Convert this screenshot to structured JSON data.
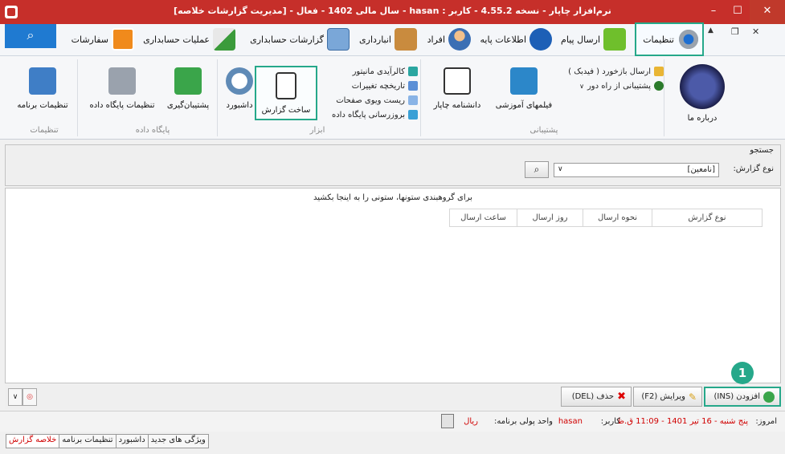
{
  "window": {
    "title": "نرم‌افزار چاپار - نسخه 4.55.2 - کاربر : hasan - سال مالی 1402 - فعال - [مدیریت گزارشات خلاصه]",
    "min": "–",
    "max": "☐",
    "close": "✕"
  },
  "tabs": [
    {
      "id": "settings",
      "label": "تنظیمات"
    },
    {
      "id": "send-message",
      "label": "ارسال پیام"
    },
    {
      "id": "base-info",
      "label": "اطلاعات پایه"
    },
    {
      "id": "people",
      "label": "افراد"
    },
    {
      "id": "warehouse",
      "label": "انبارداری"
    },
    {
      "id": "accounting-reports",
      "label": "گزارشات حسابداری"
    },
    {
      "id": "accounting-ops",
      "label": "عملیات حسابداری"
    },
    {
      "id": "orders",
      "label": "سفارشات"
    }
  ],
  "ribbon": {
    "about": "درباره ما",
    "feedback": "ارسال  بازخورد ( فیدبک )",
    "remote_support": "پشتیبانی از راه دور",
    "training_videos": "فیلمهای آموزشی",
    "chapar_encyclopedia": "دانشنامه چاپار",
    "support_group": "پشتیبانی",
    "monitor_calendar": "کالرآیدی مانیتور",
    "change_history": "تاریخچه تغییرات",
    "reset_pages": "ریست ویوی صفحات",
    "update_db": "بروزرسانی پایگاه داده",
    "build_report": "ساخت گزارش",
    "dashboard": "داشبورد",
    "tools_group": "ابزار",
    "backup": "پشتیبان‌گیری",
    "db_settings": "تنظیمات پایگاه داده",
    "db_group": "پایگاه داده",
    "program_settings": "تنظیمات برنامه",
    "settings_group": "تنظیمات"
  },
  "search": {
    "legend": "جستجو",
    "report_type_label": "نوع گزارش:",
    "report_type_value": "[نامعین]"
  },
  "grid": {
    "group_hint": "برای گروهبندی ستونها، ستونی را به اینجا بکشید",
    "columns": [
      "نوع گزارش",
      "نحوه ارسال",
      "روز ارسال",
      "ساعت ارسال"
    ]
  },
  "actions": {
    "add": "افزودن (INS)",
    "edit": "ویرایش (F2)",
    "delete": "حذف (DEL)",
    "step": "1"
  },
  "status": {
    "today_label": "امروز:",
    "today_value": "پنج شنبه - 16 تیر 1401 - 11:09 ق.ظ",
    "user_label": "کاربر:",
    "user_value": "hasan",
    "currency_label": "واحد پولی برنامه:",
    "currency_value": "ریال"
  },
  "bottom_tabs": [
    "خلاصه گزارش",
    "تنظیمات برنامه",
    "داشبورد",
    "ویژگی های جدید"
  ],
  "colors": {
    "accent": "#26a88a",
    "titlebar": "#c62f2a",
    "search": "#1f7ad1"
  }
}
